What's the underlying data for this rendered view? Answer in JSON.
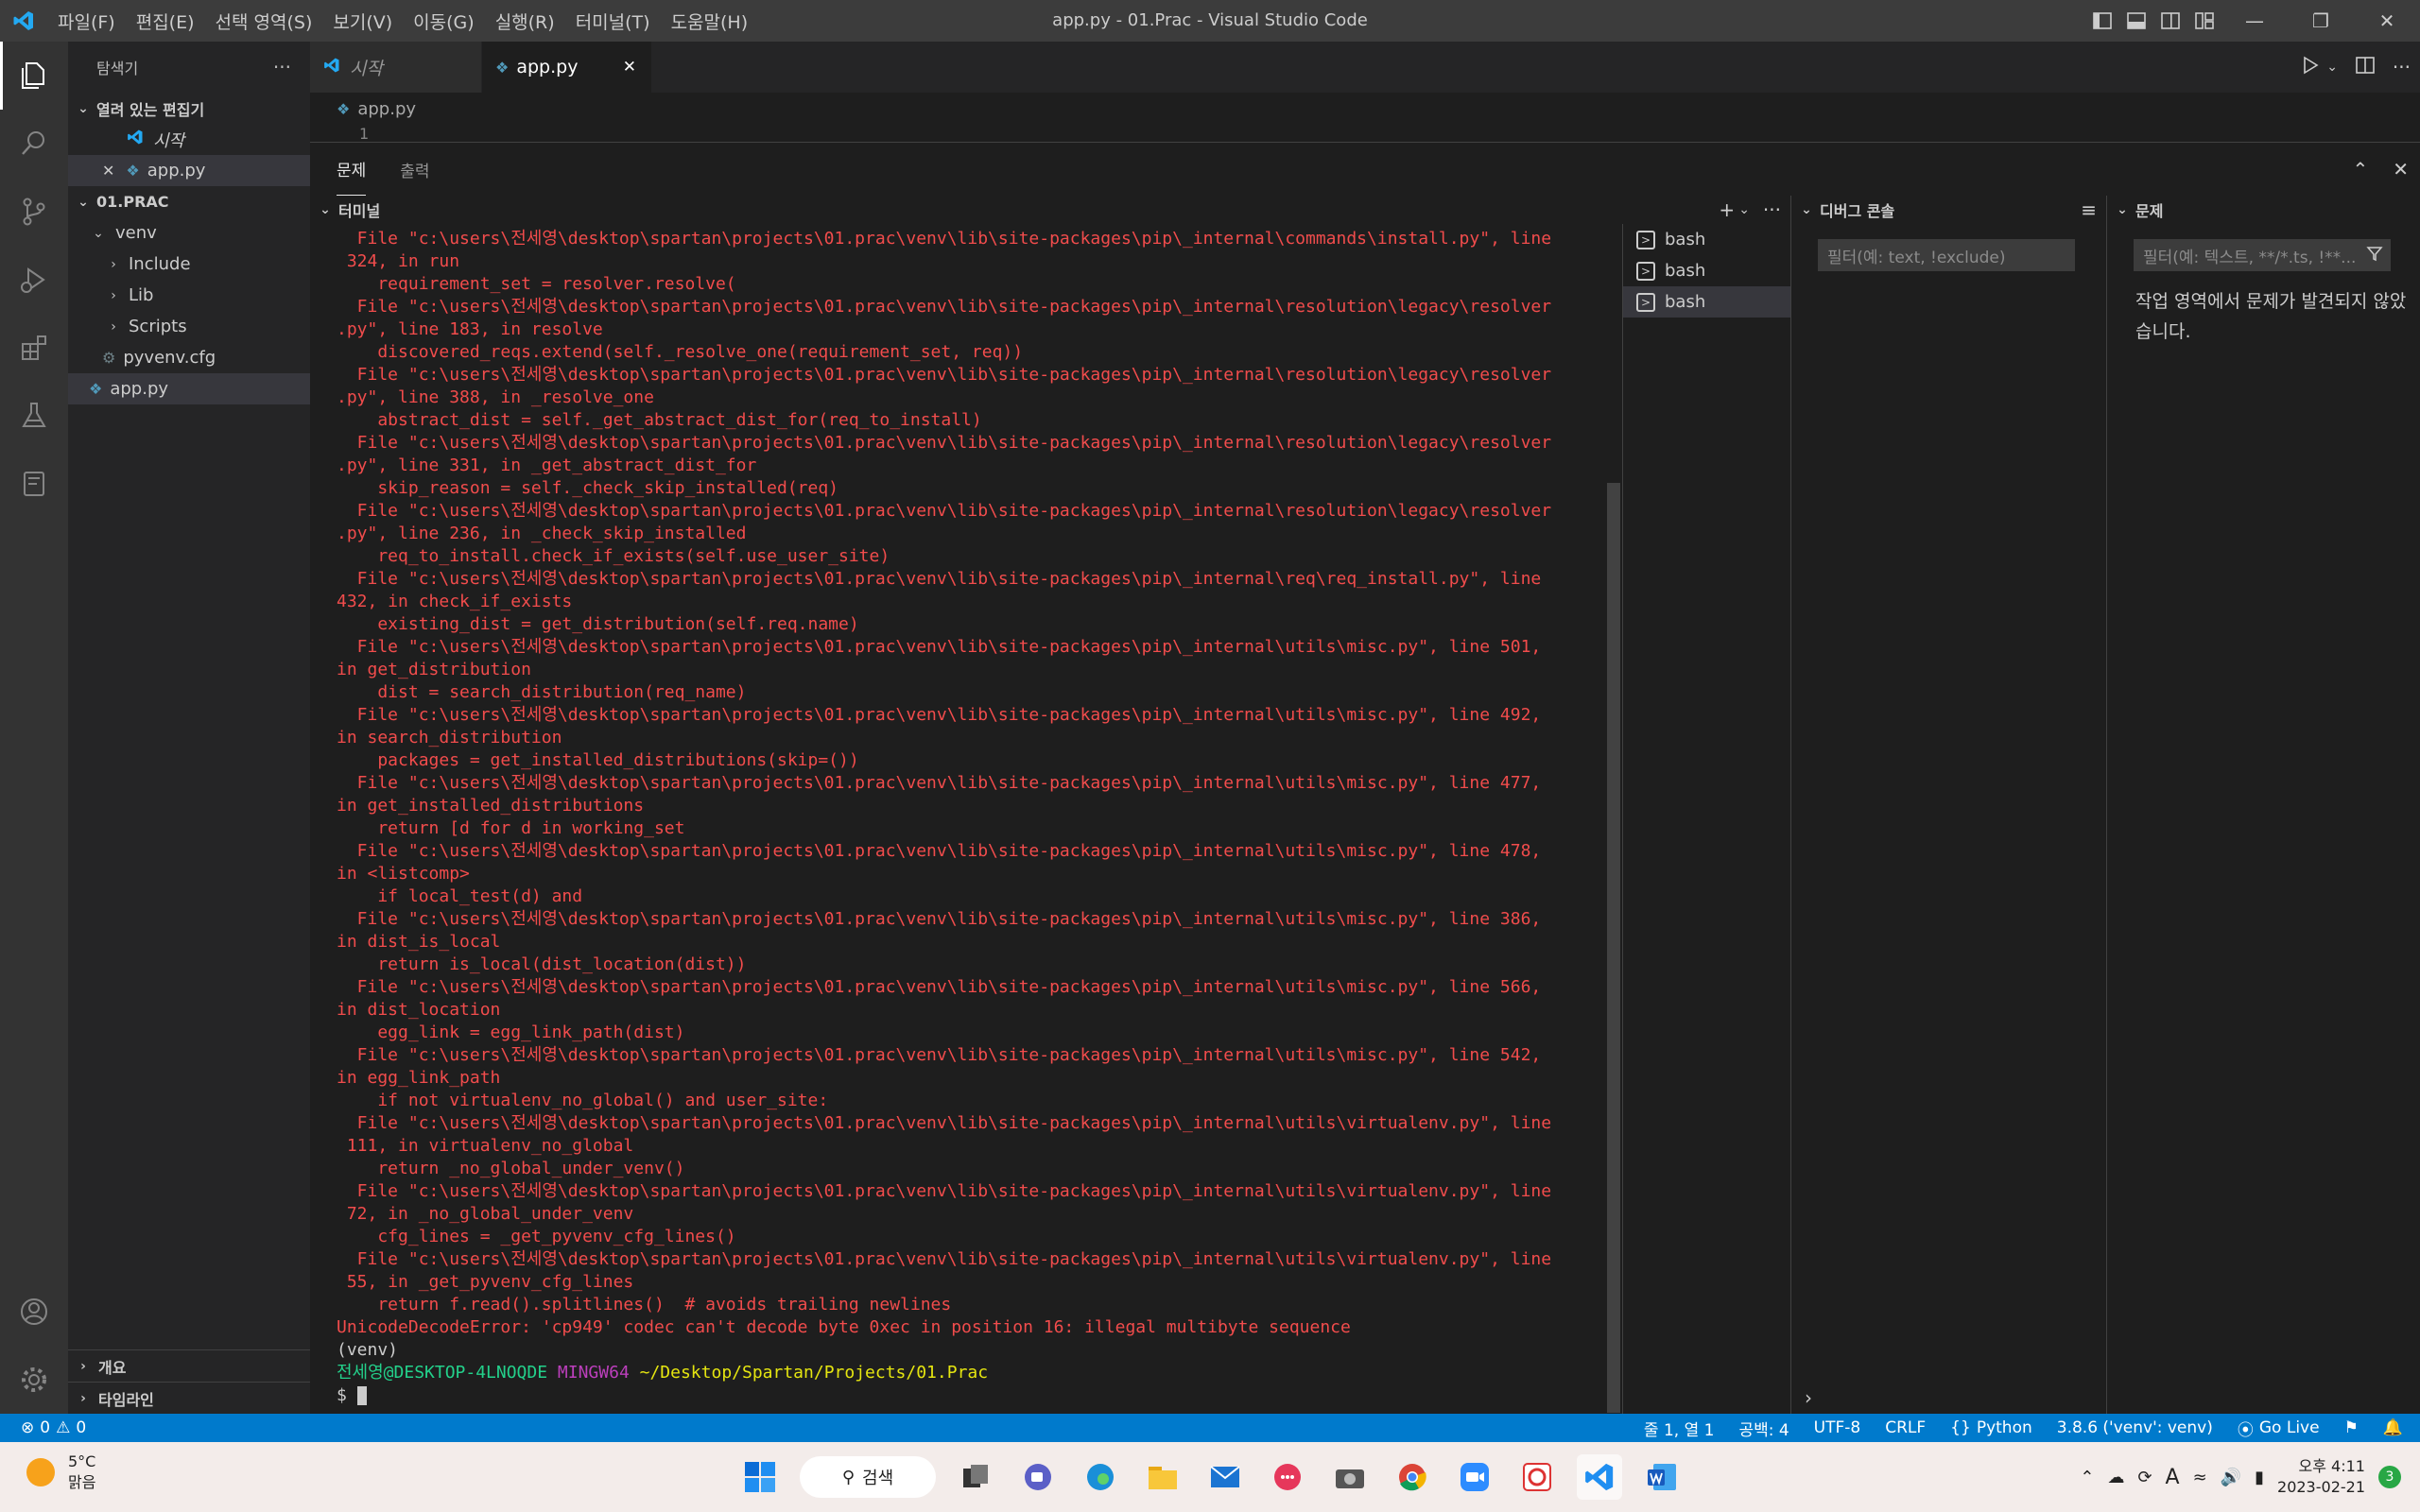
{
  "window": {
    "title": "app.py - 01.Prac - Visual Studio Code"
  },
  "menu": [
    "파일(F)",
    "편집(E)",
    "선택 영역(S)",
    "보기(V)",
    "이동(G)",
    "실행(R)",
    "터미널(T)",
    "도움말(H)"
  ],
  "sidebar": {
    "title": "탐색기",
    "open_editors_label": "열려 있는 편집기",
    "open_editors": [
      {
        "label": "시작"
      },
      {
        "label": "app.py"
      }
    ],
    "folder_label": "01.PRAC",
    "tree": [
      {
        "label": "venv",
        "depth": 1
      },
      {
        "label": "Include",
        "depth": 2
      },
      {
        "label": "Lib",
        "depth": 2
      },
      {
        "label": "Scripts",
        "depth": 2
      },
      {
        "label": "pyvenv.cfg",
        "depth": 2
      },
      {
        "label": "app.py",
        "depth": 1
      }
    ],
    "outline_label": "개요",
    "timeline_label": "타임라인"
  },
  "tabs": [
    {
      "label": "시작"
    },
    {
      "label": "app.py",
      "close": "✕"
    }
  ],
  "breadcrumb": "app.py",
  "editor": {
    "line_number": "1"
  },
  "panel": {
    "tabs": [
      "문제",
      "출력"
    ],
    "terminal_label": "터미널",
    "terminal_lines": [
      "  File \"c:\\users\\전세영\\desktop\\spartan\\projects\\01.prac\\venv\\lib\\site-packages\\pip\\_internal\\commands\\install.py\", line",
      " 324, in run",
      "    requirement_set = resolver.resolve(",
      "  File \"c:\\users\\전세영\\desktop\\spartan\\projects\\01.prac\\venv\\lib\\site-packages\\pip\\_internal\\resolution\\legacy\\resolver",
      ".py\", line 183, in resolve",
      "    discovered_reqs.extend(self._resolve_one(requirement_set, req))",
      "  File \"c:\\users\\전세영\\desktop\\spartan\\projects\\01.prac\\venv\\lib\\site-packages\\pip\\_internal\\resolution\\legacy\\resolver",
      ".py\", line 388, in _resolve_one",
      "    abstract_dist = self._get_abstract_dist_for(req_to_install)",
      "  File \"c:\\users\\전세영\\desktop\\spartan\\projects\\01.prac\\venv\\lib\\site-packages\\pip\\_internal\\resolution\\legacy\\resolver",
      ".py\", line 331, in _get_abstract_dist_for",
      "    skip_reason = self._check_skip_installed(req)",
      "  File \"c:\\users\\전세영\\desktop\\spartan\\projects\\01.prac\\venv\\lib\\site-packages\\pip\\_internal\\resolution\\legacy\\resolver",
      ".py\", line 236, in _check_skip_installed",
      "    req_to_install.check_if_exists(self.use_user_site)",
      "  File \"c:\\users\\전세영\\desktop\\spartan\\projects\\01.prac\\venv\\lib\\site-packages\\pip\\_internal\\req\\req_install.py\", line",
      "432, in check_if_exists",
      "    existing_dist = get_distribution(self.req.name)",
      "  File \"c:\\users\\전세영\\desktop\\spartan\\projects\\01.prac\\venv\\lib\\site-packages\\pip\\_internal\\utils\\misc.py\", line 501,",
      "in get_distribution",
      "    dist = search_distribution(req_name)",
      "  File \"c:\\users\\전세영\\desktop\\spartan\\projects\\01.prac\\venv\\lib\\site-packages\\pip\\_internal\\utils\\misc.py\", line 492,",
      "in search_distribution",
      "    packages = get_installed_distributions(skip=())",
      "  File \"c:\\users\\전세영\\desktop\\spartan\\projects\\01.prac\\venv\\lib\\site-packages\\pip\\_internal\\utils\\misc.py\", line 477,",
      "in get_installed_distributions",
      "    return [d for d in working_set",
      "  File \"c:\\users\\전세영\\desktop\\spartan\\projects\\01.prac\\venv\\lib\\site-packages\\pip\\_internal\\utils\\misc.py\", line 478,",
      "in <listcomp>",
      "    if local_test(d) and",
      "  File \"c:\\users\\전세영\\desktop\\spartan\\projects\\01.prac\\venv\\lib\\site-packages\\pip\\_internal\\utils\\misc.py\", line 386,",
      "in dist_is_local",
      "    return is_local(dist_location(dist))",
      "  File \"c:\\users\\전세영\\desktop\\spartan\\projects\\01.prac\\venv\\lib\\site-packages\\pip\\_internal\\utils\\misc.py\", line 566,",
      "in dist_location",
      "    egg_link = egg_link_path(dist)",
      "  File \"c:\\users\\전세영\\desktop\\spartan\\projects\\01.prac\\venv\\lib\\site-packages\\pip\\_internal\\utils\\misc.py\", line 542,",
      "in egg_link_path",
      "    if not virtualenv_no_global() and user_site:",
      "  File \"c:\\users\\전세영\\desktop\\spartan\\projects\\01.prac\\venv\\lib\\site-packages\\pip\\_internal\\utils\\virtualenv.py\", line",
      " 111, in virtualenv_no_global",
      "    return _no_global_under_venv()",
      "  File \"c:\\users\\전세영\\desktop\\spartan\\projects\\01.prac\\venv\\lib\\site-packages\\pip\\_internal\\utils\\virtualenv.py\", line",
      " 72, in _no_global_under_venv",
      "    cfg_lines = _get_pyvenv_cfg_lines()",
      "  File \"c:\\users\\전세영\\desktop\\spartan\\projects\\01.prac\\venv\\lib\\site-packages\\pip\\_internal\\utils\\virtualenv.py\", line",
      " 55, in _get_pyvenv_cfg_lines",
      "    return f.read().splitlines()  # avoids trailing newlines",
      "UnicodeDecodeError: 'cp949' codec can't decode byte 0xec in position 16: illegal multibyte sequence"
    ],
    "venv_line": "(venv)",
    "prompt": {
      "user": "전세영@DESKTOP-4LNOQDE",
      "shell": "MINGW64",
      "path": "~/Desktop/Spartan/Projects/01.Prac",
      "symbol": "$"
    },
    "terminals": [
      "bash",
      "bash",
      "bash"
    ],
    "debug_label": "디버그 콘솔",
    "debug_filter_placeholder": "필터(예: text, !exclude)",
    "problems_label": "문제",
    "problems_filter_placeholder": "필터(예: 텍스트, **/*.ts, !**...",
    "problems_message": "작업 영역에서 문제가 발견되지 않았습니다."
  },
  "statusbar": {
    "errors": "0",
    "warnings": "0",
    "position": "줄 1, 열 1",
    "spaces": "공백: 4",
    "encoding": "UTF-8",
    "eol": "CRLF",
    "language": "Python",
    "interpreter": "3.8.6 ('venv': venv)",
    "golive": "Go Live"
  },
  "taskbar": {
    "temp": "5°C",
    "weather": "맑음",
    "search": "검색",
    "time": "오후 4:11",
    "date": "2023-02-21",
    "notifications": "3",
    "ime": "A"
  },
  "colors": {
    "accent": "#007acc",
    "error_text": "#f14c4c",
    "prompt_user": "#23d18b",
    "prompt_shell": "#bc3fbc",
    "prompt_path": "#e5e510"
  }
}
